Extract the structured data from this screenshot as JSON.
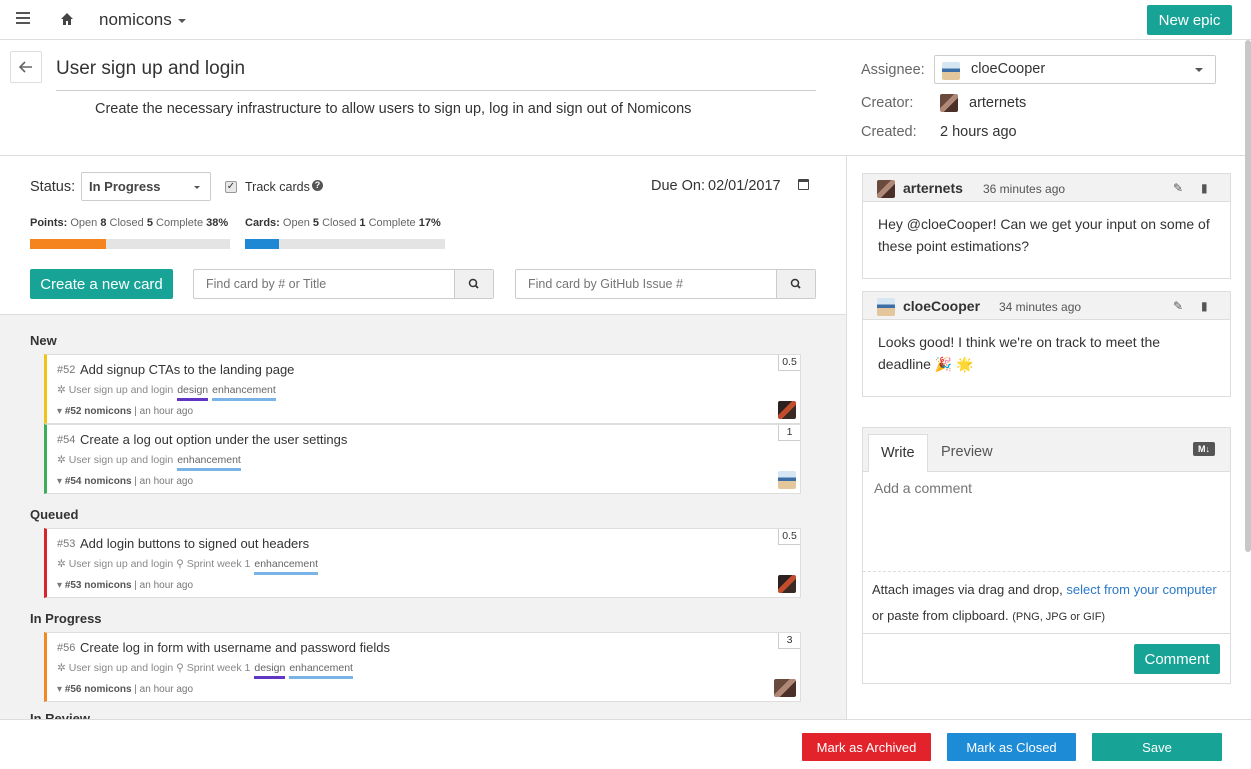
{
  "topbar": {
    "project": "nomicons",
    "new_epic": "New epic"
  },
  "epic": {
    "title": "User sign up and login",
    "description": "Create the necessary infrastructure to allow users to sign up, log in and sign out of Nomicons",
    "assignee_label": "Assignee:",
    "assignee": "cloeCooper",
    "creator_label": "Creator:",
    "creator": "arternets",
    "created_label": "Created:",
    "created": "2 hours ago"
  },
  "controls": {
    "status_label": "Status:",
    "status": "In Progress",
    "track_cards": "Track cards",
    "due_label": "Due On:",
    "due_date": "02/01/2017",
    "points": {
      "label": "Points:",
      "open_label": "Open",
      "open": "8",
      "closed_label": "Closed",
      "closed": "5",
      "complete_label": "Complete",
      "complete": "38%",
      "fraction": 0.38
    },
    "cards": {
      "label": "Cards:",
      "open_label": "Open",
      "open": "5",
      "closed_label": "Closed",
      "closed": "1",
      "complete_label": "Complete",
      "complete": "17%",
      "fraction": 0.17
    },
    "create_card": "Create a new card",
    "search_title_placeholder": "Find card by # or Title",
    "search_github_placeholder": "Find card by GitHub Issue #"
  },
  "groups": {
    "new": "New",
    "queued": "Queued",
    "in_progress": "In Progress",
    "in_review": "In Review"
  },
  "cards": [
    {
      "num": "#52",
      "title": "Add signup CTAs to the landing page",
      "epic": "User sign up and login",
      "sprint": "",
      "labels": [
        "design",
        "enhancement"
      ],
      "issue": "#52 nomicons",
      "time": "an hour ago",
      "points": "0.5",
      "color": "#f0c419"
    },
    {
      "num": "#54",
      "title": "Create a log out option under the user settings",
      "epic": "User sign up and login",
      "sprint": "",
      "labels": [
        "enhancement"
      ],
      "issue": "#54 nomicons",
      "time": "an hour ago",
      "points": "1",
      "color": "#3cae5a"
    },
    {
      "num": "#53",
      "title": "Add login buttons to signed out headers",
      "epic": "User sign up and login",
      "sprint": "Sprint week 1",
      "labels": [
        "enhancement"
      ],
      "issue": "#53 nomicons",
      "time": "an hour ago",
      "points": "0.5",
      "color": "#d9232d"
    },
    {
      "num": "#56",
      "title": "Create log in form with username and password fields",
      "epic": "User sign up and login",
      "sprint": "Sprint week 1",
      "labels": [
        "design",
        "enhancement"
      ],
      "issue": "#56 nomicons",
      "time": "an hour ago",
      "points": "3",
      "color": "#f08a24"
    }
  ],
  "comments": [
    {
      "author": "arternets",
      "time": "36 minutes ago",
      "body": "Hey @cloeCooper! Can we get your input on some of these point estimations?"
    },
    {
      "author": "cloeCooper",
      "time": "34 minutes ago",
      "body": "Looks good! I think we're on track to meet the deadline 🎉 🌟"
    }
  ],
  "editor": {
    "write_tab": "Write",
    "preview_tab": "Preview",
    "placeholder": "Add a comment",
    "attach_prefix": "Attach images via drag and drop, ",
    "attach_link": "select from your computer",
    "attach_suffix": " or paste from clipboard. ",
    "attach_types": "(PNG, JPG or GIF)",
    "submit": "Comment"
  },
  "footer": {
    "archive": "Mark as Archived",
    "close": "Mark as Closed",
    "save": "Save"
  },
  "colors": {
    "teal": "#17a497",
    "points_bar": "#f5841f",
    "cards_bar": "#1e88d4",
    "archive": "#e3232c",
    "close": "#1d8bd6",
    "save": "#17a497"
  }
}
